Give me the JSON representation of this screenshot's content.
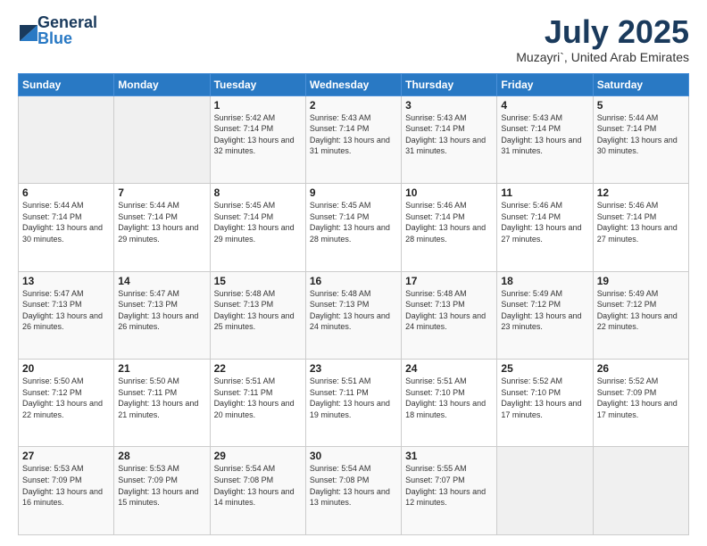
{
  "logo": {
    "general": "General",
    "blue": "Blue"
  },
  "title": "July 2025",
  "location": "Muzayri`, United Arab Emirates",
  "weekdays": [
    "Sunday",
    "Monday",
    "Tuesday",
    "Wednesday",
    "Thursday",
    "Friday",
    "Saturday"
  ],
  "weeks": [
    [
      {
        "day": "",
        "info": ""
      },
      {
        "day": "",
        "info": ""
      },
      {
        "day": "1",
        "info": "Sunrise: 5:42 AM\nSunset: 7:14 PM\nDaylight: 13 hours and 32 minutes."
      },
      {
        "day": "2",
        "info": "Sunrise: 5:43 AM\nSunset: 7:14 PM\nDaylight: 13 hours and 31 minutes."
      },
      {
        "day": "3",
        "info": "Sunrise: 5:43 AM\nSunset: 7:14 PM\nDaylight: 13 hours and 31 minutes."
      },
      {
        "day": "4",
        "info": "Sunrise: 5:43 AM\nSunset: 7:14 PM\nDaylight: 13 hours and 31 minutes."
      },
      {
        "day": "5",
        "info": "Sunrise: 5:44 AM\nSunset: 7:14 PM\nDaylight: 13 hours and 30 minutes."
      }
    ],
    [
      {
        "day": "6",
        "info": "Sunrise: 5:44 AM\nSunset: 7:14 PM\nDaylight: 13 hours and 30 minutes."
      },
      {
        "day": "7",
        "info": "Sunrise: 5:44 AM\nSunset: 7:14 PM\nDaylight: 13 hours and 29 minutes."
      },
      {
        "day": "8",
        "info": "Sunrise: 5:45 AM\nSunset: 7:14 PM\nDaylight: 13 hours and 29 minutes."
      },
      {
        "day": "9",
        "info": "Sunrise: 5:45 AM\nSunset: 7:14 PM\nDaylight: 13 hours and 28 minutes."
      },
      {
        "day": "10",
        "info": "Sunrise: 5:46 AM\nSunset: 7:14 PM\nDaylight: 13 hours and 28 minutes."
      },
      {
        "day": "11",
        "info": "Sunrise: 5:46 AM\nSunset: 7:14 PM\nDaylight: 13 hours and 27 minutes."
      },
      {
        "day": "12",
        "info": "Sunrise: 5:46 AM\nSunset: 7:14 PM\nDaylight: 13 hours and 27 minutes."
      }
    ],
    [
      {
        "day": "13",
        "info": "Sunrise: 5:47 AM\nSunset: 7:13 PM\nDaylight: 13 hours and 26 minutes."
      },
      {
        "day": "14",
        "info": "Sunrise: 5:47 AM\nSunset: 7:13 PM\nDaylight: 13 hours and 26 minutes."
      },
      {
        "day": "15",
        "info": "Sunrise: 5:48 AM\nSunset: 7:13 PM\nDaylight: 13 hours and 25 minutes."
      },
      {
        "day": "16",
        "info": "Sunrise: 5:48 AM\nSunset: 7:13 PM\nDaylight: 13 hours and 24 minutes."
      },
      {
        "day": "17",
        "info": "Sunrise: 5:48 AM\nSunset: 7:13 PM\nDaylight: 13 hours and 24 minutes."
      },
      {
        "day": "18",
        "info": "Sunrise: 5:49 AM\nSunset: 7:12 PM\nDaylight: 13 hours and 23 minutes."
      },
      {
        "day": "19",
        "info": "Sunrise: 5:49 AM\nSunset: 7:12 PM\nDaylight: 13 hours and 22 minutes."
      }
    ],
    [
      {
        "day": "20",
        "info": "Sunrise: 5:50 AM\nSunset: 7:12 PM\nDaylight: 13 hours and 22 minutes."
      },
      {
        "day": "21",
        "info": "Sunrise: 5:50 AM\nSunset: 7:11 PM\nDaylight: 13 hours and 21 minutes."
      },
      {
        "day": "22",
        "info": "Sunrise: 5:51 AM\nSunset: 7:11 PM\nDaylight: 13 hours and 20 minutes."
      },
      {
        "day": "23",
        "info": "Sunrise: 5:51 AM\nSunset: 7:11 PM\nDaylight: 13 hours and 19 minutes."
      },
      {
        "day": "24",
        "info": "Sunrise: 5:51 AM\nSunset: 7:10 PM\nDaylight: 13 hours and 18 minutes."
      },
      {
        "day": "25",
        "info": "Sunrise: 5:52 AM\nSunset: 7:10 PM\nDaylight: 13 hours and 17 minutes."
      },
      {
        "day": "26",
        "info": "Sunrise: 5:52 AM\nSunset: 7:09 PM\nDaylight: 13 hours and 17 minutes."
      }
    ],
    [
      {
        "day": "27",
        "info": "Sunrise: 5:53 AM\nSunset: 7:09 PM\nDaylight: 13 hours and 16 minutes."
      },
      {
        "day": "28",
        "info": "Sunrise: 5:53 AM\nSunset: 7:09 PM\nDaylight: 13 hours and 15 minutes."
      },
      {
        "day": "29",
        "info": "Sunrise: 5:54 AM\nSunset: 7:08 PM\nDaylight: 13 hours and 14 minutes."
      },
      {
        "day": "30",
        "info": "Sunrise: 5:54 AM\nSunset: 7:08 PM\nDaylight: 13 hours and 13 minutes."
      },
      {
        "day": "31",
        "info": "Sunrise: 5:55 AM\nSunset: 7:07 PM\nDaylight: 13 hours and 12 minutes."
      },
      {
        "day": "",
        "info": ""
      },
      {
        "day": "",
        "info": ""
      }
    ]
  ]
}
